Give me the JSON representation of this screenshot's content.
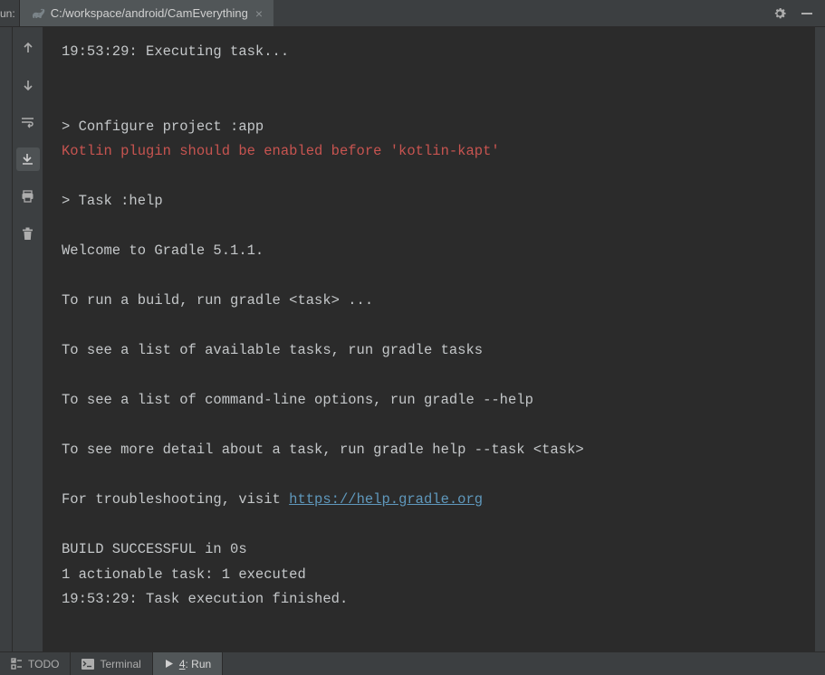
{
  "top": {
    "run_label": "un:",
    "tab_title": "C:/workspace/android/CamEverything"
  },
  "console": {
    "l0": "19:53:29: Executing task...",
    "l1": "",
    "l2": "",
    "l3": "> Configure project :app",
    "l4": "Kotlin plugin should be enabled before 'kotlin-kapt'",
    "l5": "",
    "l6": "> Task :help",
    "l7": "",
    "l8": "Welcome to Gradle 5.1.1.",
    "l9": "",
    "l10": "To run a build, run gradle <task> ...",
    "l11": "",
    "l12": "To see a list of available tasks, run gradle tasks",
    "l13": "",
    "l14": "To see a list of command-line options, run gradle --help",
    "l15": "",
    "l16": "To see more detail about a task, run gradle help --task <task>",
    "l17": "",
    "l18a": "For troubleshooting, visit ",
    "l18b": "https://help.gradle.org",
    "l19": "",
    "l20": "BUILD SUCCESSFUL in 0s",
    "l21": "1 actionable task: 1 executed",
    "l22": "19:53:29: Task execution finished."
  },
  "bottom": {
    "todo_label": "TODO",
    "terminal_label": "Terminal",
    "run_num": "4",
    "run_label": ": Run"
  }
}
